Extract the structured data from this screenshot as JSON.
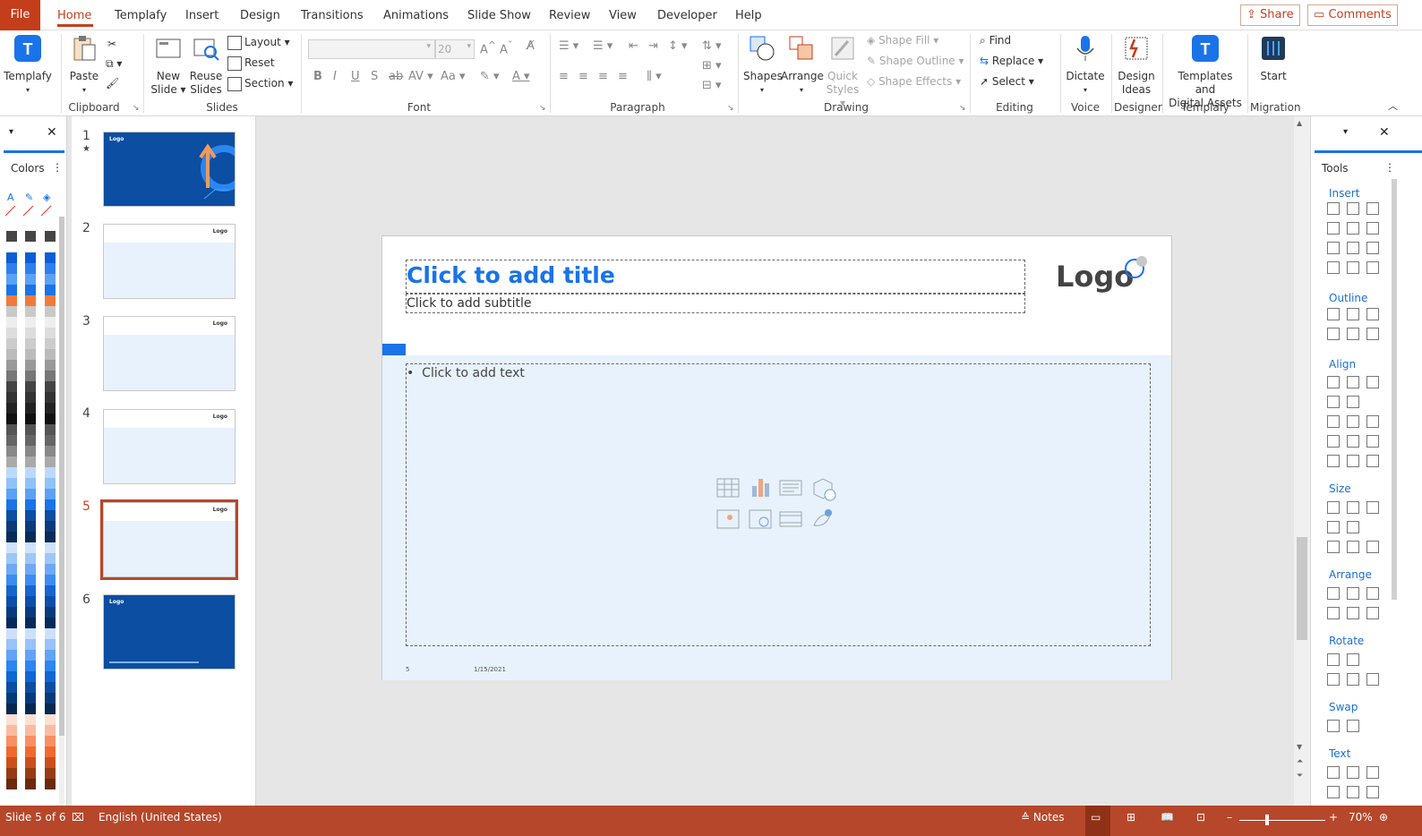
{
  "tabs": {
    "file": "File",
    "items": [
      "Home",
      "Templafy",
      "Insert",
      "Design",
      "Transitions",
      "Animations",
      "Slide Show",
      "Review",
      "View",
      "Developer",
      "Help"
    ],
    "share": "Share",
    "comments": "Comments"
  },
  "ribbon": {
    "templafy_btn": "Templafy",
    "paste": "Paste",
    "new_slide": [
      "New",
      "Slide"
    ],
    "reuse_slides": [
      "Reuse",
      "Slides"
    ],
    "layout": "Layout",
    "reset": "Reset",
    "section": "Section",
    "font_size": "20",
    "shapes": "Shapes",
    "arrange": "Arrange",
    "quick_styles": [
      "Quick",
      "Styles"
    ],
    "shape_fill": "Shape Fill",
    "shape_outline": "Shape Outline",
    "shape_effects": "Shape Effects",
    "find": "Find",
    "replace": "Replace",
    "select": "Select",
    "dictate": "Dictate",
    "design_ideas": [
      "Design",
      "Ideas"
    ],
    "templates_assets": [
      "Templates and",
      "Digital Assets"
    ],
    "start": "Start",
    "groups": {
      "templafy_blank": "",
      "clipboard": "Clipboard",
      "slides": "Slides",
      "font": "Font",
      "paragraph": "Paragraph",
      "drawing": "Drawing",
      "editing": "Editing",
      "voice": "Voice",
      "designer": "Designer",
      "templafy": "Templafy",
      "migration": "Migration"
    }
  },
  "colors_panel": {
    "title": "Colors"
  },
  "thumbnails": [
    {
      "num": "1",
      "star": "★",
      "logo": "Logo"
    },
    {
      "num": "2",
      "logo": "Logo"
    },
    {
      "num": "3",
      "logo": "Logo"
    },
    {
      "num": "4",
      "logo": "Logo"
    },
    {
      "num": "5",
      "logo": "Logo"
    },
    {
      "num": "6",
      "logo": "Logo"
    }
  ],
  "slide": {
    "title_placeholder": "Click to add title",
    "subtitle_placeholder": "Click to add subtitle",
    "content_placeholder": "Click to add text",
    "logo": "Logo",
    "footer_num": "5",
    "footer_date": "1/15/2021"
  },
  "tools_panel": {
    "title": "Tools",
    "sections": [
      "Insert",
      "Outline",
      "Align",
      "Size",
      "Arrange",
      "Rotate",
      "Swap",
      "Text"
    ]
  },
  "status": {
    "slide_info": "Slide 5 of 6",
    "language": "English (United States)",
    "notes": "Notes",
    "zoom": "70%"
  },
  "accent_colors": {
    "office_accent": "#c43e1c",
    "status_bar": "#b7472a",
    "title_blue": "#1a73e8",
    "slide_body": "#e8f2fd",
    "dark_blue": "#0b4ea2"
  }
}
